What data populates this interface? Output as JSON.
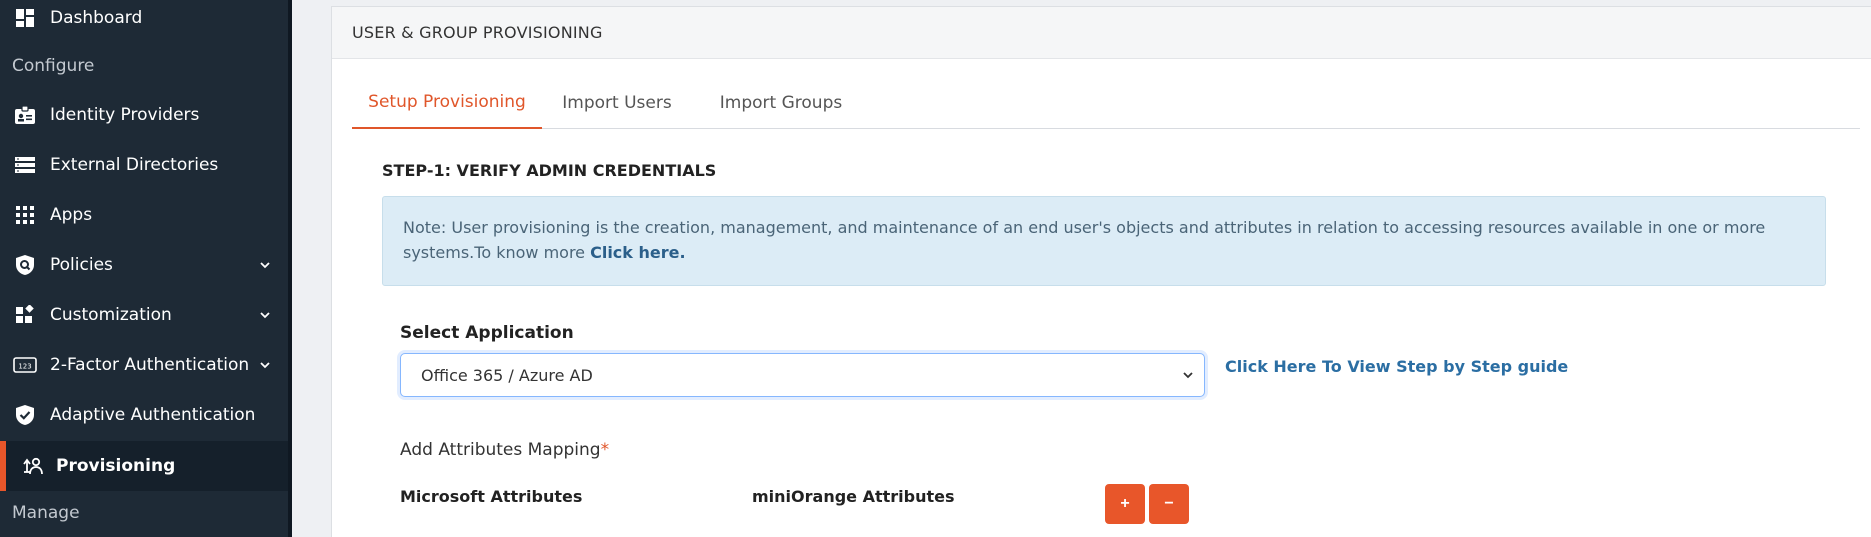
{
  "sidebar": {
    "items": [
      {
        "label": "Dashboard",
        "icon": "dashboard-icon"
      },
      {
        "label": "Identity Providers",
        "icon": "id-badge-icon"
      },
      {
        "label": "External Directories",
        "icon": "server-stack-icon"
      },
      {
        "label": "Apps",
        "icon": "grid-icon"
      },
      {
        "label": "Policies",
        "icon": "shield-search-icon"
      },
      {
        "label": "Customization",
        "icon": "widgets-icon"
      },
      {
        "label": "2-Factor Authentication",
        "icon": "otp-123-icon"
      },
      {
        "label": "Adaptive Authentication",
        "icon": "shield-check-icon"
      },
      {
        "label": "Provisioning",
        "icon": "provisioning-icon"
      }
    ],
    "sections": {
      "configure": "Configure",
      "manage": "Manage"
    }
  },
  "card": {
    "title": "USER & GROUP PROVISIONING",
    "tabs": [
      "Setup Provisioning",
      "Import Users",
      "Import Groups"
    ],
    "step_title": "STEP-1: VERIFY ADMIN CREDENTIALS",
    "note_text": "Note: User provisioning is the creation, management, and maintenance of an end user's objects and attributes in relation to accessing resources available in one or more systems.To know more ",
    "note_link": "Click here.",
    "select_label": "Select Application",
    "select_value": "Office 365 / Azure AD",
    "guide_link": "Click Here To View Step by Step guide",
    "attr_label": "Add Attributes Mapping",
    "attr_required": "*",
    "col_microsoft": "Microsoft Attributes",
    "col_miniorange": "miniOrange Attributes",
    "add_btn": "+",
    "remove_btn": "−"
  },
  "colors": {
    "accent": "#e8562a",
    "sidebar_bg": "#1e2a36",
    "note_bg": "#dcecf6",
    "link": "#2b6ea3"
  }
}
